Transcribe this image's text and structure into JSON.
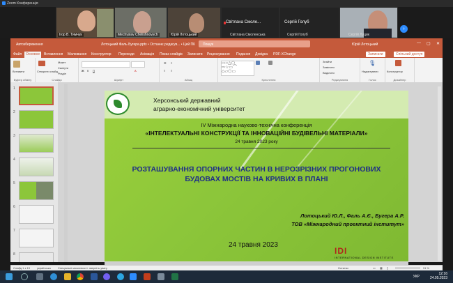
{
  "zoom": {
    "title": "Zoom Конференція",
    "participants": [
      {
        "name": "Ігор В. Тимчук",
        "kind": "video"
      },
      {
        "name": "Mechyslav Chelishnovych",
        "kind": "video"
      },
      {
        "name": "Юрій Лотоцький",
        "kind": "video"
      },
      {
        "name": "Світлана Смоле...",
        "kind": "empty"
      },
      {
        "name": "Сергій Голуб",
        "kind": "empty"
      },
      {
        "name": "",
        "kind": "video"
      }
    ],
    "participant_strip": [
      "Світлана Смоленська",
      "Сергій Голуб",
      "Сергій Луцик"
    ],
    "next_label": "›"
  },
  "powerpoint": {
    "autosave": "Автозбереження",
    "doc_title": "Лотоцький Фаль Бугера.pptx • Останнє редагув... • Цей ПК",
    "search": "Пошук",
    "user": "Юрій Лотоцький",
    "tabs": [
      "Файл",
      "Основне",
      "Вставлення",
      "Малювання",
      "Конструктор",
      "Переходи",
      "Анімація",
      "Показ слайдів",
      "Записати",
      "Рецензування",
      "Подання",
      "Довідка",
      "PDF-XChange"
    ],
    "active_tab": "Основне",
    "record_button": "Записати",
    "share_button": "Спільний доступ",
    "ribbon": {
      "paste": "Вставити",
      "new_slide": "Створити слайд",
      "layout": "Макет",
      "reset": "Скинути",
      "section": "Розділ",
      "find": "Знайти",
      "replace": "Замінити",
      "select": "Виділити",
      "dictate": "Надиктувати",
      "designer": "Конструктор",
      "groups": [
        "Буфер обміну",
        "Слайди",
        "Шрифт",
        "Абзац",
        "Креслення",
        "Редагування",
        "Голос",
        "Дизайнер"
      ]
    },
    "thumb_numbers": [
      "1",
      "2",
      "3",
      "4",
      "5",
      "6",
      "7",
      "8"
    ],
    "status_left": "Слайд 1 з 13",
    "status_lang": "українська",
    "status_access": "Спеціальні можливості: зверніть увагу",
    "status_notes": "Нотатки",
    "zoom_level": "91 %"
  },
  "slide": {
    "university_line1": "Херсонський державний",
    "university_line2": "аграрно-економічний університет",
    "conference_line": "IV Міжнародна науково-технічна конференція",
    "conference_title": "«ІНТЕЛЕКТУАЛЬНІ КОНСТРУКЦІЇ ТА ІННОВАЦІЙНІ БУДІВЕЛЬНІ МАТЕРІАЛИ»",
    "conference_date": "24 травня 2023 року",
    "paper_title_line1": "РОЗТАШУВАННЯ ОПОРНИХ ЧАСТИН В НЕРОЗРІЗНИХ ПРОГОНОВИХ",
    "paper_title_line2": "БУДОВАХ МОСТІВ НА КРИВИХ В ПЛАНІ",
    "authors": "Лотоцький Ю.Л., Фаль А.Є., Бугера А.Р.",
    "organization": "ТОВ «Міжнародний проектний інститут»",
    "date": "24 травня 2023",
    "logo_letters": "IDI",
    "logo_subtitle": "INTERNATIONAL DESIGN INSTITUTE"
  },
  "taskbar": {
    "lang": "УКР",
    "time": "12:16",
    "date": "24.05.2023",
    "icons": [
      "start",
      "search",
      "task-view",
      "edge",
      "chrome",
      "explorer",
      "word",
      "powerpoint",
      "zoom",
      "viber",
      "telegram",
      "settings"
    ]
  },
  "colors": {
    "ppt_accent": "#c55a3b",
    "slide_green": "#8cc63a",
    "title_blue": "#1f2f86",
    "zoom_blue": "#2d8cff"
  }
}
